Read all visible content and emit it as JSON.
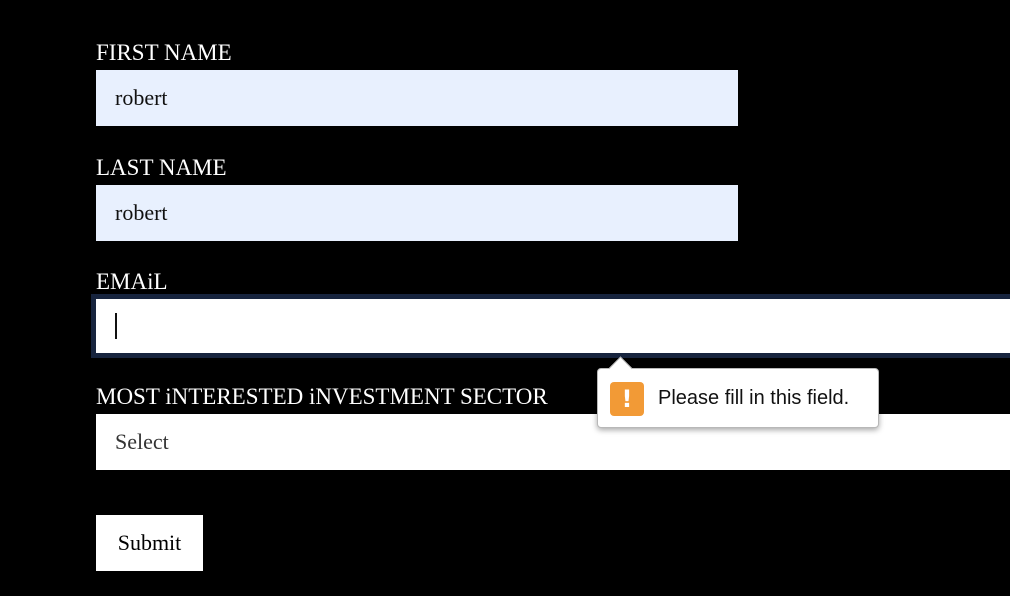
{
  "form": {
    "first_name": {
      "label": "FIRST NAME",
      "value": "robert"
    },
    "last_name": {
      "label": "LAST NAME",
      "value": "robert"
    },
    "email": {
      "label": "EMAiL",
      "value": ""
    },
    "sector": {
      "label": "MOST iNTERESTED iNVESTMENT SECTOR",
      "selected": "Select"
    },
    "submit_label": "Submit"
  },
  "validation_tooltip": {
    "icon": "warning-icon",
    "icon_glyph": "!",
    "message": "Please fill in this field.",
    "icon_color": "#f29a36"
  },
  "colors": {
    "background": "#000000",
    "autofill": "#e8f0fe",
    "focus_border": "#17243e"
  }
}
